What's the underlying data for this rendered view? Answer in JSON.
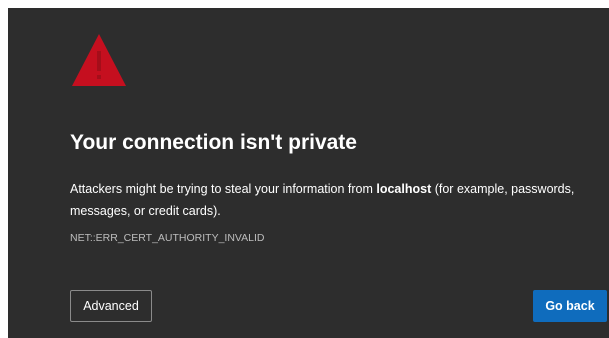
{
  "page": {
    "warning_icon": "warning-triangle-icon",
    "heading": "Your connection isn't private",
    "message": {
      "before": "Attackers might be trying to steal your information from ",
      "host": "localhost",
      "after": " (for example, passwords, messages, or credit cards)."
    },
    "error_code": "NET::ERR_CERT_AUTHORITY_INVALID"
  },
  "buttons": {
    "advanced_label": "Advanced",
    "go_back_label": "Go back"
  },
  "colors": {
    "background": "#2d2d2d",
    "warning_red": "#c50f1f",
    "primary_button": "#0f6cbd"
  }
}
